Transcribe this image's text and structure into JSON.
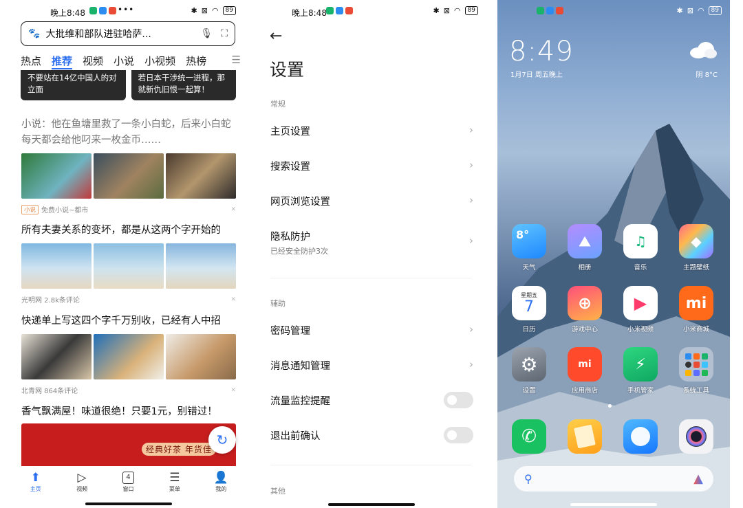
{
  "statusbar_left": {
    "time": "晚上8:48",
    "battery": "89"
  },
  "statusbar_mid": {
    "time": "晚上8:48",
    "battery": "89"
  },
  "statusbar_right": {
    "battery": "89"
  },
  "browser": {
    "search_text": "大批维和部队进驻哈萨...",
    "tabs": [
      "热点",
      "推荐",
      "视频",
      "小说",
      "小视频",
      "热榜"
    ],
    "active_tab": "推荐",
    "top_cards": [
      {
        "text": "不要站在14亿中国人的对立面"
      },
      {
        "text": "若日本干涉统一进程，那就新仇旧恨一起算！"
      }
    ],
    "feed": [
      {
        "title": "小说：他在鱼塘里救了一条小白蛇，后来小白蛇每天都会给他叼来一枚金币……",
        "tag": "小说",
        "source": "免费小说~都市"
      },
      {
        "title": "所有夫妻关系的变坏，都是从这两个字开始的",
        "source": "光明网  2.8k条评论"
      },
      {
        "title": "快递单上写这四个字千万别收，已经有人中招",
        "source": "北青网  864条评论"
      },
      {
        "title": "香气飘满屋！味道很绝！只要1元，别错过！",
        "ad_text": "经典好茶 年货佳"
      }
    ],
    "bottom_nav": [
      {
        "label": "主页",
        "icon": "home-icon"
      },
      {
        "label": "视频",
        "icon": "play-icon"
      },
      {
        "label": "窗口",
        "icon": "window-count-icon",
        "count": "4"
      },
      {
        "label": "菜单",
        "icon": "menu-icon"
      },
      {
        "label": "我的",
        "icon": "profile-icon"
      }
    ],
    "accent_color": "#2d6ff0"
  },
  "settings": {
    "title": "设置",
    "sections": [
      {
        "label": "常规"
      },
      {
        "label": "辅助"
      },
      {
        "label": "其他"
      }
    ],
    "items": [
      {
        "label": "主页设置",
        "type": "link"
      },
      {
        "label": "搜索设置",
        "type": "link"
      },
      {
        "label": "网页浏览设置",
        "type": "link"
      },
      {
        "label": "隐私防护",
        "sub": "已经安全防护3次",
        "type": "link"
      },
      {
        "label": "密码管理",
        "type": "link"
      },
      {
        "label": "消息通知管理",
        "type": "link"
      },
      {
        "label": "流量监控提醒",
        "type": "toggle",
        "on": false
      },
      {
        "label": "退出前确认",
        "type": "toggle",
        "on": false
      }
    ]
  },
  "launcher": {
    "clock": "8:49",
    "date": "1月7日 周五晚上",
    "weather": "阴  8°C",
    "apps": [
      {
        "label": "天气",
        "glyph": "8°"
      },
      {
        "label": "相册",
        "glyph": ""
      },
      {
        "label": "音乐",
        "glyph": "♫"
      },
      {
        "label": "主题壁纸",
        "glyph": ""
      },
      {
        "label": "日历",
        "glyph": "7",
        "sub": "星期五"
      },
      {
        "label": "游戏中心",
        "glyph": "⊕"
      },
      {
        "label": "小米视频",
        "glyph": "▶"
      },
      {
        "label": "小米商城",
        "glyph": "mi"
      },
      {
        "label": "设置",
        "glyph": "⚙"
      },
      {
        "label": "应用商店",
        "glyph": "mi"
      },
      {
        "label": "手机管家",
        "glyph": "⚡"
      },
      {
        "label": "系统工具",
        "glyph": ""
      }
    ],
    "dock": [
      {
        "label": "",
        "glyph": "✆",
        "icon": "phone-icon"
      },
      {
        "label": "",
        "glyph": "",
        "icon": "notes-icon"
      },
      {
        "label": "",
        "glyph": "",
        "icon": "browser-icon"
      },
      {
        "label": "",
        "glyph": "",
        "icon": "camera-icon"
      }
    ]
  }
}
